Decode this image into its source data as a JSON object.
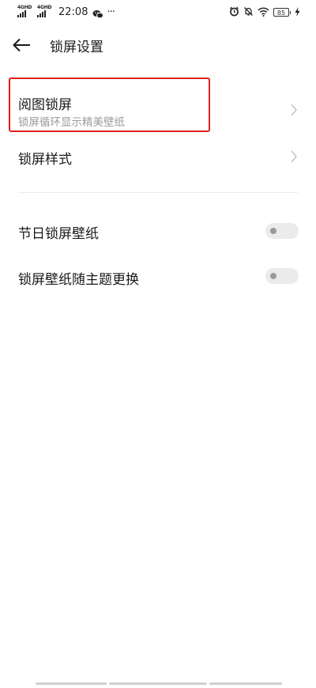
{
  "status_bar": {
    "network1": "4GHD",
    "network2": "4GHD",
    "time": "22:08",
    "overflow": "···",
    "battery": "85",
    "icons": [
      "signal-icon",
      "wechat-icon",
      "alarm-icon",
      "mute-icon",
      "wifi-icon",
      "battery-icon",
      "charging-icon"
    ]
  },
  "header": {
    "title": "锁屏设置",
    "back_icon": "back-arrow-icon"
  },
  "items": [
    {
      "title": "阅图锁屏",
      "subtitle": "锁屏循环显示精美壁纸",
      "control": "chevron",
      "highlighted": true
    },
    {
      "title": "锁屏样式",
      "control": "chevron"
    },
    {
      "title": "节日锁屏壁纸",
      "control": "toggle",
      "on": false
    },
    {
      "title": "锁屏壁纸随主题更换",
      "control": "toggle",
      "on": false
    }
  ],
  "colors": {
    "highlight_border": "#e02020",
    "subtitle": "#9b9b9b",
    "toggle_track": "#ebebeb",
    "toggle_knob": "#9a9a9a"
  }
}
